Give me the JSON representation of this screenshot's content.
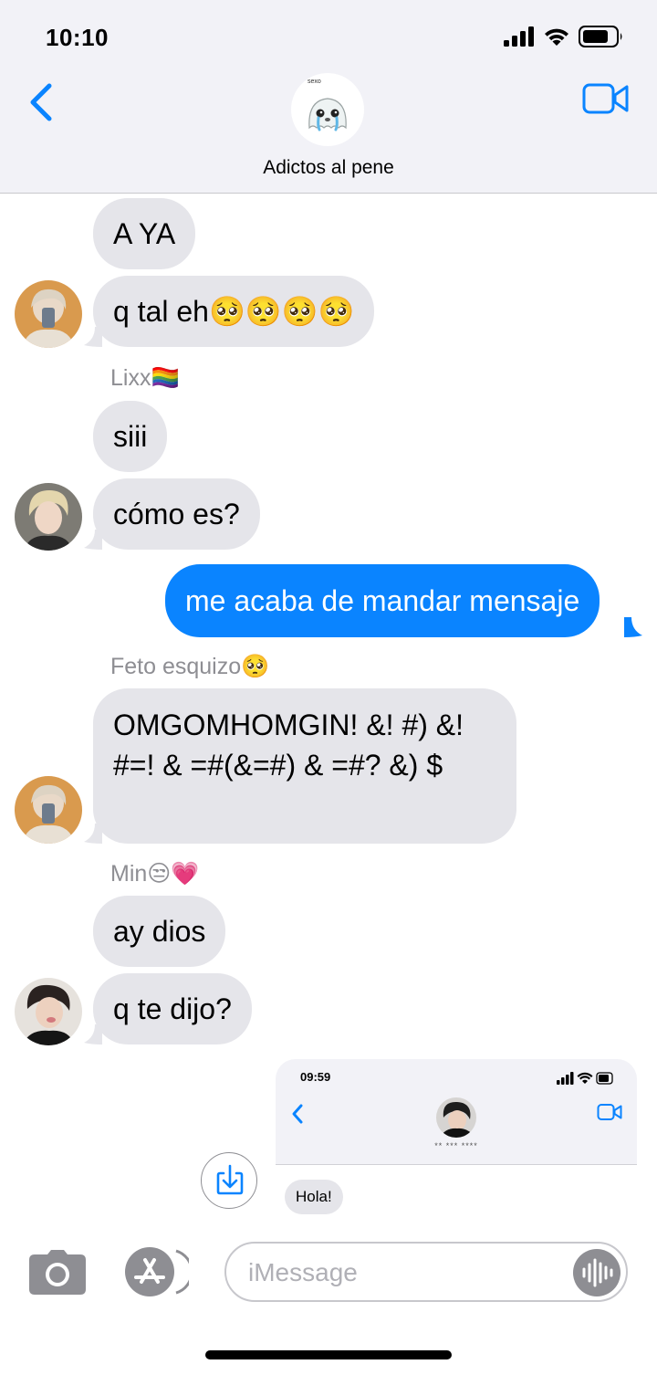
{
  "status_bar": {
    "time": "10:10"
  },
  "header": {
    "group_name": "Adictos al pene",
    "avatar_caption": "sexo"
  },
  "messages": [
    {
      "text": "A YA"
    },
    {
      "text": "q tal eh🥺🥺🥺🥺"
    },
    {
      "sender": "Lixx🏳️‍🌈"
    },
    {
      "text": "siii"
    },
    {
      "text": "cómo es?"
    },
    {
      "text": "me acaba de mandar mensaje"
    },
    {
      "sender": "Feto esquizo🥺"
    },
    {
      "text": "OMGOMHOMGIN! &! #) &! #=! & =#(&=#) & =#? &) $"
    },
    {
      "sender": "Min😒💗"
    },
    {
      "text": "ay dios"
    },
    {
      "text": "q te dijo?"
    }
  ],
  "shared_screenshot": {
    "time": "09:59",
    "contact": "** *** ****",
    "message": "Hola!"
  },
  "input": {
    "placeholder": "iMessage"
  },
  "colors": {
    "accent": "#0a84ff",
    "incoming_bubble": "#e5e5ea",
    "header_bg": "#f2f2f7"
  },
  "icons": [
    "back-chevron-icon",
    "video-camera-icon",
    "signal-icon",
    "wifi-icon",
    "battery-icon",
    "camera-icon",
    "app-store-icon",
    "audio-waveform-icon",
    "save-download-icon"
  ]
}
